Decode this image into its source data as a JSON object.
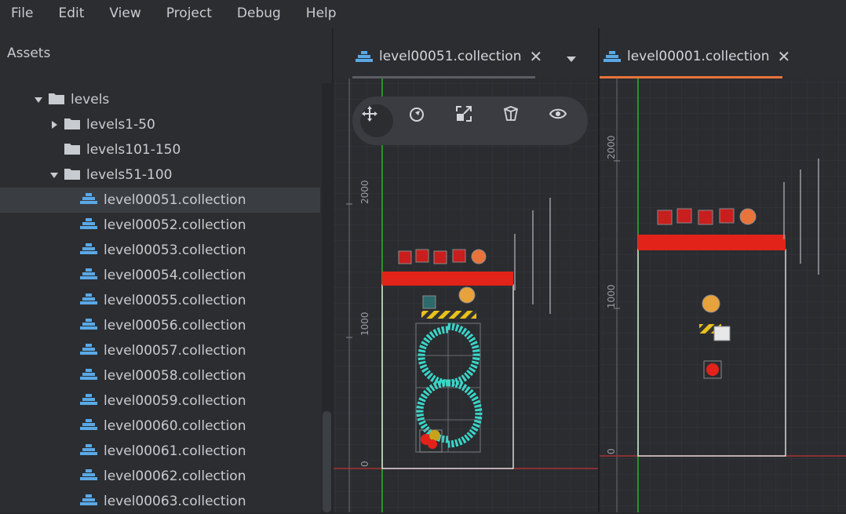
{
  "menu": [
    "File",
    "Edit",
    "View",
    "Project",
    "Debug",
    "Help"
  ],
  "assets": {
    "title": "Assets",
    "tree": [
      {
        "label": "levels",
        "type": "folder",
        "expanded": true,
        "depth": 0
      },
      {
        "label": "levels1-50",
        "type": "folder",
        "expanded": false,
        "depth": 1
      },
      {
        "label": "levels101-150",
        "type": "folder",
        "expanded": null,
        "depth": 1
      },
      {
        "label": "levels51-100",
        "type": "folder",
        "expanded": true,
        "depth": 1
      },
      {
        "label": "level00051.collection",
        "type": "collection",
        "depth": 2,
        "selected": true
      },
      {
        "label": "level00052.collection",
        "type": "collection",
        "depth": 2
      },
      {
        "label": "level00053.collection",
        "type": "collection",
        "depth": 2
      },
      {
        "label": "level00054.collection",
        "type": "collection",
        "depth": 2
      },
      {
        "label": "level00055.collection",
        "type": "collection",
        "depth": 2
      },
      {
        "label": "level00056.collection",
        "type": "collection",
        "depth": 2
      },
      {
        "label": "level00057.collection",
        "type": "collection",
        "depth": 2
      },
      {
        "label": "level00058.collection",
        "type": "collection",
        "depth": 2
      },
      {
        "label": "level00059.collection",
        "type": "collection",
        "depth": 2
      },
      {
        "label": "level00060.collection",
        "type": "collection",
        "depth": 2
      },
      {
        "label": "level00061.collection",
        "type": "collection",
        "depth": 2
      },
      {
        "label": "level00062.collection",
        "type": "collection",
        "depth": 2
      },
      {
        "label": "level00063.collection",
        "type": "collection",
        "depth": 2
      }
    ]
  },
  "editor_left": {
    "tab_label": "level00051.collection",
    "ruler_labels": [
      "2000",
      "1000",
      "0"
    ],
    "tools": [
      "move-tool",
      "rotate-tool",
      "scale-tool",
      "perspective-tool",
      "camera-reset-tool"
    ]
  },
  "editor_right": {
    "tab_label": "level00001.collection",
    "ruler_labels": [
      "2000",
      "1000",
      "0"
    ]
  },
  "colors": {
    "accent": "#e8743b",
    "collection_icon": "#5aa9e6",
    "axis_green": "#2f8f2f",
    "axis_red": "#a83232",
    "level_bar": "#e2231a",
    "teal": "#3ad6c8"
  }
}
